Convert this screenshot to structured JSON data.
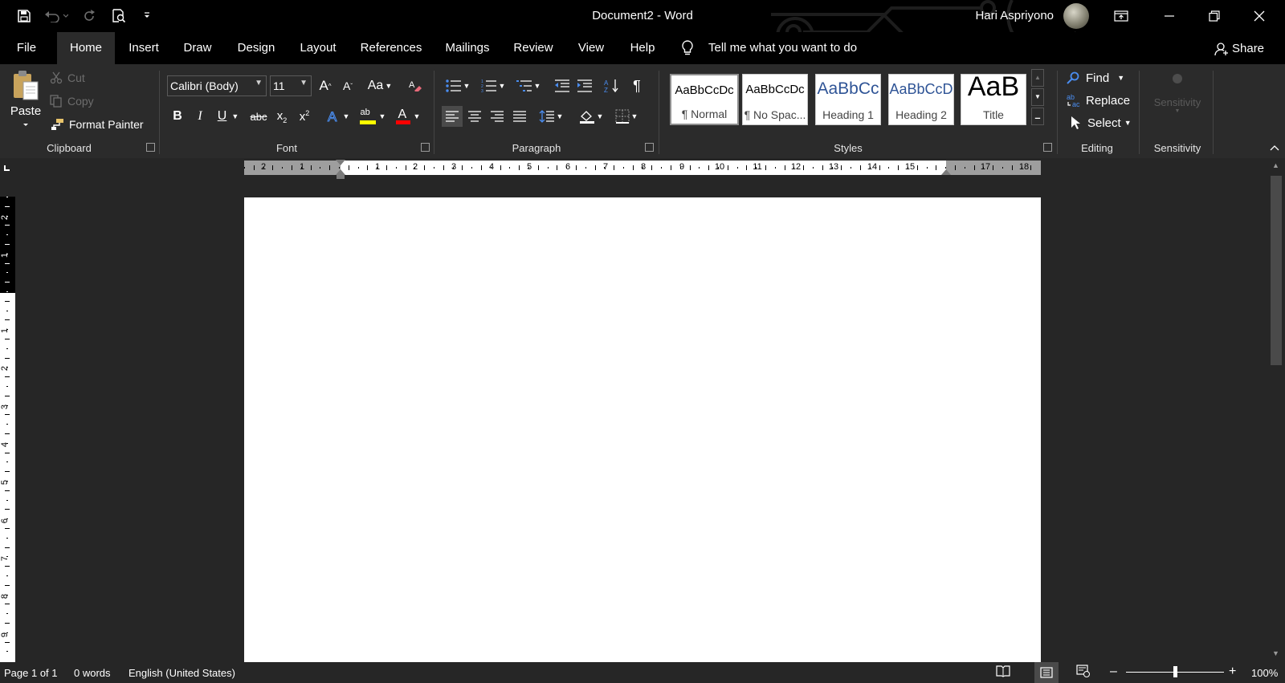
{
  "window": {
    "title": "Document2  -  Word",
    "user_name": "Hari Aspriyono"
  },
  "tabs": [
    "File",
    "Home",
    "Insert",
    "Draw",
    "Design",
    "Layout",
    "References",
    "Mailings",
    "Review",
    "View",
    "Help"
  ],
  "tell_me": "Tell me what you want to do",
  "share": "Share",
  "clipboard": {
    "paste": "Paste",
    "cut": "Cut",
    "copy": "Copy",
    "format_painter": "Format Painter",
    "group": "Clipboard"
  },
  "font": {
    "name": "Calibri (Body)",
    "size": "11",
    "group": "Font",
    "case_label": "Aa",
    "bold": "B",
    "italic": "I",
    "underline": "U",
    "strikethrough": "abc",
    "highlight_label": "ab",
    "color_label": "A",
    "grow_label": "A",
    "shrink_label": "A"
  },
  "paragraph": {
    "group": "Paragraph",
    "pilcrow": "¶"
  },
  "styles": {
    "group": "Styles",
    "items": [
      {
        "sample": "AaBbCcDc",
        "name": "¶ Normal"
      },
      {
        "sample": "AaBbCcDc",
        "name": "¶ No Spac..."
      },
      {
        "sample": "AaBbCc",
        "name": "Heading 1"
      },
      {
        "sample": "AaBbCcD",
        "name": "Heading 2"
      },
      {
        "sample": "AaB",
        "name": "Title"
      }
    ]
  },
  "editing": {
    "find": "Find",
    "replace": "Replace",
    "select": "Select",
    "group": "Editing"
  },
  "sensitivity": {
    "label": "Sensitivity",
    "group": "Sensitivity"
  },
  "ruler": {
    "horizontal": [
      "2",
      "1",
      "1",
      "2",
      "3",
      "4",
      "5",
      "6",
      "7",
      "8",
      "9",
      "10",
      "11",
      "12",
      "13",
      "14",
      "15",
      "17",
      "18"
    ],
    "vertical": [
      "2",
      "1",
      "1",
      "2",
      "3",
      "4",
      "5",
      "6",
      "7",
      "8",
      "9"
    ]
  },
  "status": {
    "page": "Page 1 of 1",
    "words": "0 words",
    "language": "English (United States)",
    "zoom": "100%",
    "zoom_fraction": 0.5
  },
  "colors": {
    "titlebar": "#000000",
    "ribbon": "#2b2b2b",
    "workspace": "#262626",
    "highlight_yellow": "#ffff00",
    "font_red": "#ff0000",
    "heading_blue": "#2f5496"
  }
}
